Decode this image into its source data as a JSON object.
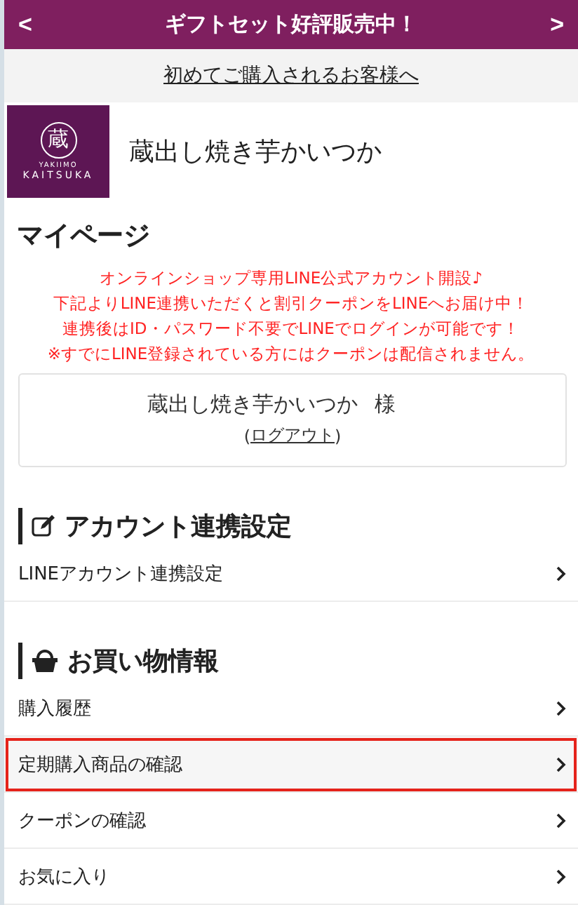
{
  "banner": {
    "prev": "<",
    "text": "ギフトセット好評販売中！",
    "next": ">"
  },
  "first_time_link": "初めてご購入されるお客様へ",
  "header": {
    "logo": {
      "mark": "蔵",
      "small": "YAKIIMO",
      "name": "KAITSUKA"
    },
    "shop_name": "蔵出し焼き芋かいつか"
  },
  "page_title": "マイページ",
  "notice": [
    "オンラインショップ専用LINE公式アカウント開設♪",
    "下記よりLINE連携いただくと割引クーポンをLINEへお届け中！",
    "連携後はID・パスワード不要でLINEでログインが可能です！",
    "※すでにLINE登録されている方にはクーポンは配信されません。"
  ],
  "user_card": {
    "name": "蔵出し焼き芋かいつか",
    "honorific": "様",
    "open_paren": "(",
    "logout": "ログアウト",
    "close_paren": ")"
  },
  "sections": [
    {
      "kind": "edit",
      "title": "アカウント連携設定",
      "items": [
        {
          "label": "LINEアカウント連携設定",
          "selected": false
        }
      ]
    },
    {
      "kind": "basket",
      "title": "お買い物情報",
      "items": [
        {
          "label": "購入履歴",
          "selected": false
        },
        {
          "label": "定期購入商品の確認",
          "selected": true
        },
        {
          "label": "クーポンの確認",
          "selected": false
        },
        {
          "label": "お気に入り",
          "selected": false
        }
      ]
    }
  ]
}
